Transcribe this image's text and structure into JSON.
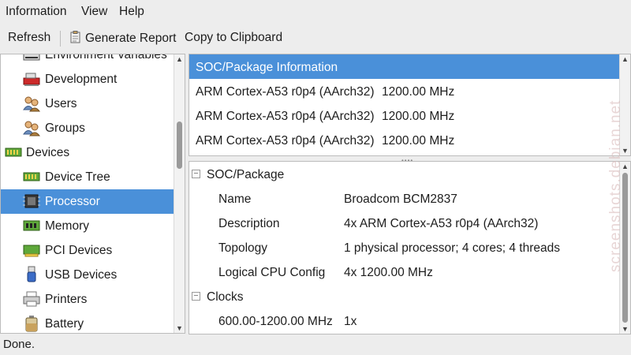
{
  "menu": [
    "Information",
    "View",
    "Help"
  ],
  "toolbar": {
    "refresh": "Refresh",
    "generate_report": "Generate Report",
    "copy_clipboard": "Copy to Clipboard"
  },
  "sidebar": {
    "items": [
      {
        "label": "Environment Variables",
        "icon": "env-icon"
      },
      {
        "label": "Development",
        "icon": "development-icon"
      },
      {
        "label": "Users",
        "icon": "users-icon"
      },
      {
        "label": "Groups",
        "icon": "groups-icon"
      },
      {
        "label": "Devices",
        "icon": "devices-icon"
      },
      {
        "label": "Device Tree",
        "icon": "device-tree-icon"
      },
      {
        "label": "Processor",
        "icon": "processor-icon",
        "selected": true
      },
      {
        "label": "Memory",
        "icon": "memory-icon"
      },
      {
        "label": "PCI Devices",
        "icon": "pci-icon"
      },
      {
        "label": "USB Devices",
        "icon": "usb-icon"
      },
      {
        "label": "Printers",
        "icon": "printer-icon"
      },
      {
        "label": "Battery",
        "icon": "battery-icon"
      }
    ]
  },
  "processor_list": {
    "rows": [
      {
        "name": "SOC/Package Information",
        "freq": ""
      },
      {
        "name": "ARM Cortex-A53 r0p4 (AArch32)",
        "freq": "1200.00 MHz"
      },
      {
        "name": "ARM Cortex-A53 r0p4 (AArch32)",
        "freq": "1200.00 MHz"
      },
      {
        "name": "ARM Cortex-A53 r0p4 (AArch32)",
        "freq": "1200.00 MHz"
      }
    ]
  },
  "details": {
    "section1": "SOC/Package",
    "props": [
      {
        "key": "Name",
        "value": "Broadcom BCM2837"
      },
      {
        "key": "Description",
        "value": "4x ARM Cortex-A53 r0p4 (AArch32)"
      },
      {
        "key": "Topology",
        "value": "1 physical processor; 4 cores; 4 threads"
      },
      {
        "key": "Logical CPU Config",
        "value": "4x 1200.00 MHz"
      }
    ],
    "section2": "Clocks",
    "clocks": [
      {
        "key": "600.00-1200.00 MHz",
        "value": "1x"
      }
    ],
    "collapse_symbol": "−"
  },
  "status": "Done.",
  "watermark": "screenshots.debian.net",
  "colors": {
    "selection": "#4a90d9",
    "selection_text": "#ffffff"
  }
}
